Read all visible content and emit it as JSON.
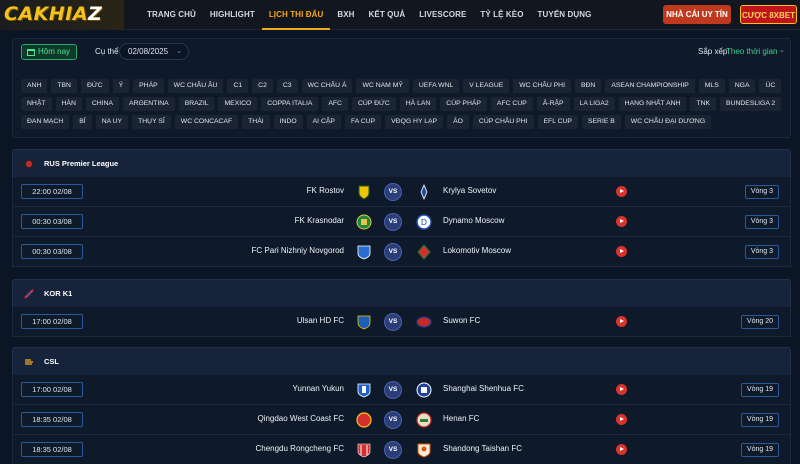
{
  "header": {
    "logo_main": "CAKHIA",
    "logo_z": "Z",
    "nav": [
      {
        "label": "TRANG CHỦ",
        "active": false
      },
      {
        "label": "HIGHLIGHT",
        "active": false
      },
      {
        "label": "LỊCH THI ĐẤU",
        "active": true
      },
      {
        "label": "BXH",
        "active": false
      },
      {
        "label": "KẾT QUẢ",
        "active": false
      },
      {
        "label": "LIVESCORE",
        "active": false
      },
      {
        "label": "TỶ LỆ KÈO",
        "active": false
      },
      {
        "label": "TUYỂN DỤNG",
        "active": false
      }
    ],
    "btn_nhacai": "NHÀ CÁI UY TÍN",
    "btn_cuoc": "CƯỢC 8XBET"
  },
  "filter": {
    "today_label": "Hôm nay",
    "cuthe_label": "Cụ thể",
    "date_value": "02/08/2025",
    "sort_label": "Sắp xếp:",
    "sort_value": "Theo thời gian",
    "leagues": [
      "ANH",
      "TBN",
      "ĐỨC",
      "Ý",
      "PHÁP",
      "WC CHÂU ÂU",
      "C1",
      "C2",
      "C3",
      "WC CHÂU Á",
      "WC NAM MỸ",
      "UEFA WNL",
      "V LEAGUE",
      "WC CHÂU PHI",
      "BĐN",
      "ASEAN CHAMPIONSHIP",
      "MLS",
      "NGA",
      "ÚC",
      "NHẬT",
      "HÀN",
      "CHINA",
      "ARGENTINA",
      "BRAZIL",
      "MEXICO",
      "COPPA ITALIA",
      "AFC",
      "CÚP ĐỨC",
      "HÀ LAN",
      "CÚP PHÁP",
      "AFC CUP",
      "Ả-RẬP",
      "LA LIGA2",
      "HẠNG NHẤT ANH",
      "TNK",
      "BUNDESLIGA 2",
      "ĐAN MẠCH",
      "BỈ",
      "NA UY",
      "THỤY SĨ",
      "WC CONCACAF",
      "THÁI",
      "INDO",
      "AI CẬP",
      "FA CUP",
      "VĐQG HY LẠP",
      "ÁO",
      "CÚP CHÂU PHI",
      "EFL CUP",
      "SERIE B",
      "WC CHÂU ĐẠI DƯƠNG"
    ]
  },
  "sections": [
    {
      "league": "RUS Premier League",
      "matches": [
        {
          "time": "22:00 02/08",
          "home": "FK Rostov",
          "away": "Krylya Sovetov",
          "vs": "VS",
          "round": "Vòng 3"
        },
        {
          "time": "00:30 03/08",
          "home": "FK Krasnodar",
          "away": "Dynamo Moscow",
          "vs": "VS",
          "round": "Vòng 3"
        },
        {
          "time": "00:30 03/08",
          "home": "FC Pari Nizhniy Novgorod",
          "away": "Lokomotiv Moscow",
          "vs": "VS",
          "round": "Vòng 3"
        }
      ]
    },
    {
      "league": "KOR K1",
      "matches": [
        {
          "time": "17:00 02/08",
          "home": "Ulsan HD FC",
          "away": "Suwon FC",
          "vs": "VS",
          "round": "Vòng 20"
        }
      ]
    },
    {
      "league": "CSL",
      "matches": [
        {
          "time": "17:00 02/08",
          "home": "Yunnan Yukun",
          "away": "Shanghai Shenhua FC",
          "vs": "VS",
          "round": "Vòng 19"
        },
        {
          "time": "18:35 02/08",
          "home": "Qingdao West Coast FC",
          "away": "Henan FC",
          "vs": "VS",
          "round": "Vòng 19"
        },
        {
          "time": "18:35 02/08",
          "home": "Chengdu Rongcheng FC",
          "away": "Shandong Taishan FC",
          "vs": "VS",
          "round": "Vòng 19"
        }
      ]
    }
  ],
  "colors": {
    "accent": "#f4a91b",
    "live": "#d9342b",
    "today_green": "#4ee395"
  }
}
